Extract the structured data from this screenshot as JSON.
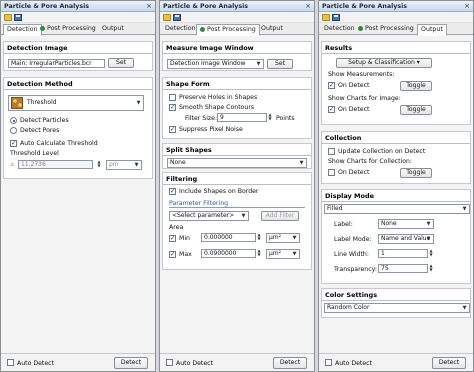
{
  "window_title": "Particle & Pore Analysis",
  "close_glyph": "×",
  "panel1": {
    "tabs": [
      "Detection",
      "Post Processing",
      "Output"
    ],
    "detection_image_title": "Detection Image",
    "image_value": "Main: IrregularParticles.bcr",
    "set_label": "Set",
    "detection_method_title": "Detection Method",
    "method_value": "Threshold",
    "detect_particles": "Detect Particles",
    "detect_pores": "Detect Pores",
    "auto_calc": "Auto Calculate Threshold",
    "threshold_level": "Threshold Level",
    "threshold_value": "11.2736",
    "threshold_unit": "pm"
  },
  "panel2": {
    "tabs": [
      "Detection",
      "Post Processing",
      "Output"
    ],
    "measure_window_title": "Measure Image Window",
    "window_value": "Detection Image Window",
    "set_label": "Set",
    "shape_form_title": "Shape Form",
    "preserve_holes": "Preserve Holes in Shapes",
    "smooth_contours": "Smooth Shape Contours",
    "filter_size_label": "Filter Size:",
    "filter_size_value": "9",
    "points_label": "Points",
    "suppress_noise": "Suppress Pixel Noise",
    "split_shapes_title": "Split Shapes",
    "split_value": "None",
    "filtering_title": "Filtering",
    "include_border": "Include Shapes on Border",
    "param_filtering": "Parameter Filtering",
    "select_param": "<Select parameter>",
    "add_filter": "Add Filter",
    "area_label": "Area",
    "min_label": "Min",
    "min_value": "0.000000",
    "max_label": "Max",
    "max_value": "0.0900000",
    "unit": "μm²"
  },
  "panel3": {
    "tabs": [
      "Detection",
      "Post Processing",
      "Output"
    ],
    "results_title": "Results",
    "setup_btn": "Setup & Classification",
    "show_measurements": "Show Measurements:",
    "on_detect": "On Detect",
    "toggle": "Toggle",
    "show_charts_image": "Show Charts for Image:",
    "collection_title": "Collection",
    "update_collection": "Update Collection on Detect",
    "show_charts_collection": "Show Charts for Collection:",
    "display_mode_title": "Display Mode",
    "display_mode_value": "Filled",
    "label_label": "Label:",
    "label_value": "None",
    "label_mode_label": "Label Mode:",
    "label_mode_value": "Name and Value",
    "line_width_label": "Line Width:",
    "line_width_value": "1",
    "transparency_label": "Transparency:",
    "transparency_value": "75",
    "color_settings_title": "Color Settings",
    "color_value": "Random Color"
  },
  "footer": {
    "auto_detect": "Auto Detect",
    "detect": "Detect"
  }
}
